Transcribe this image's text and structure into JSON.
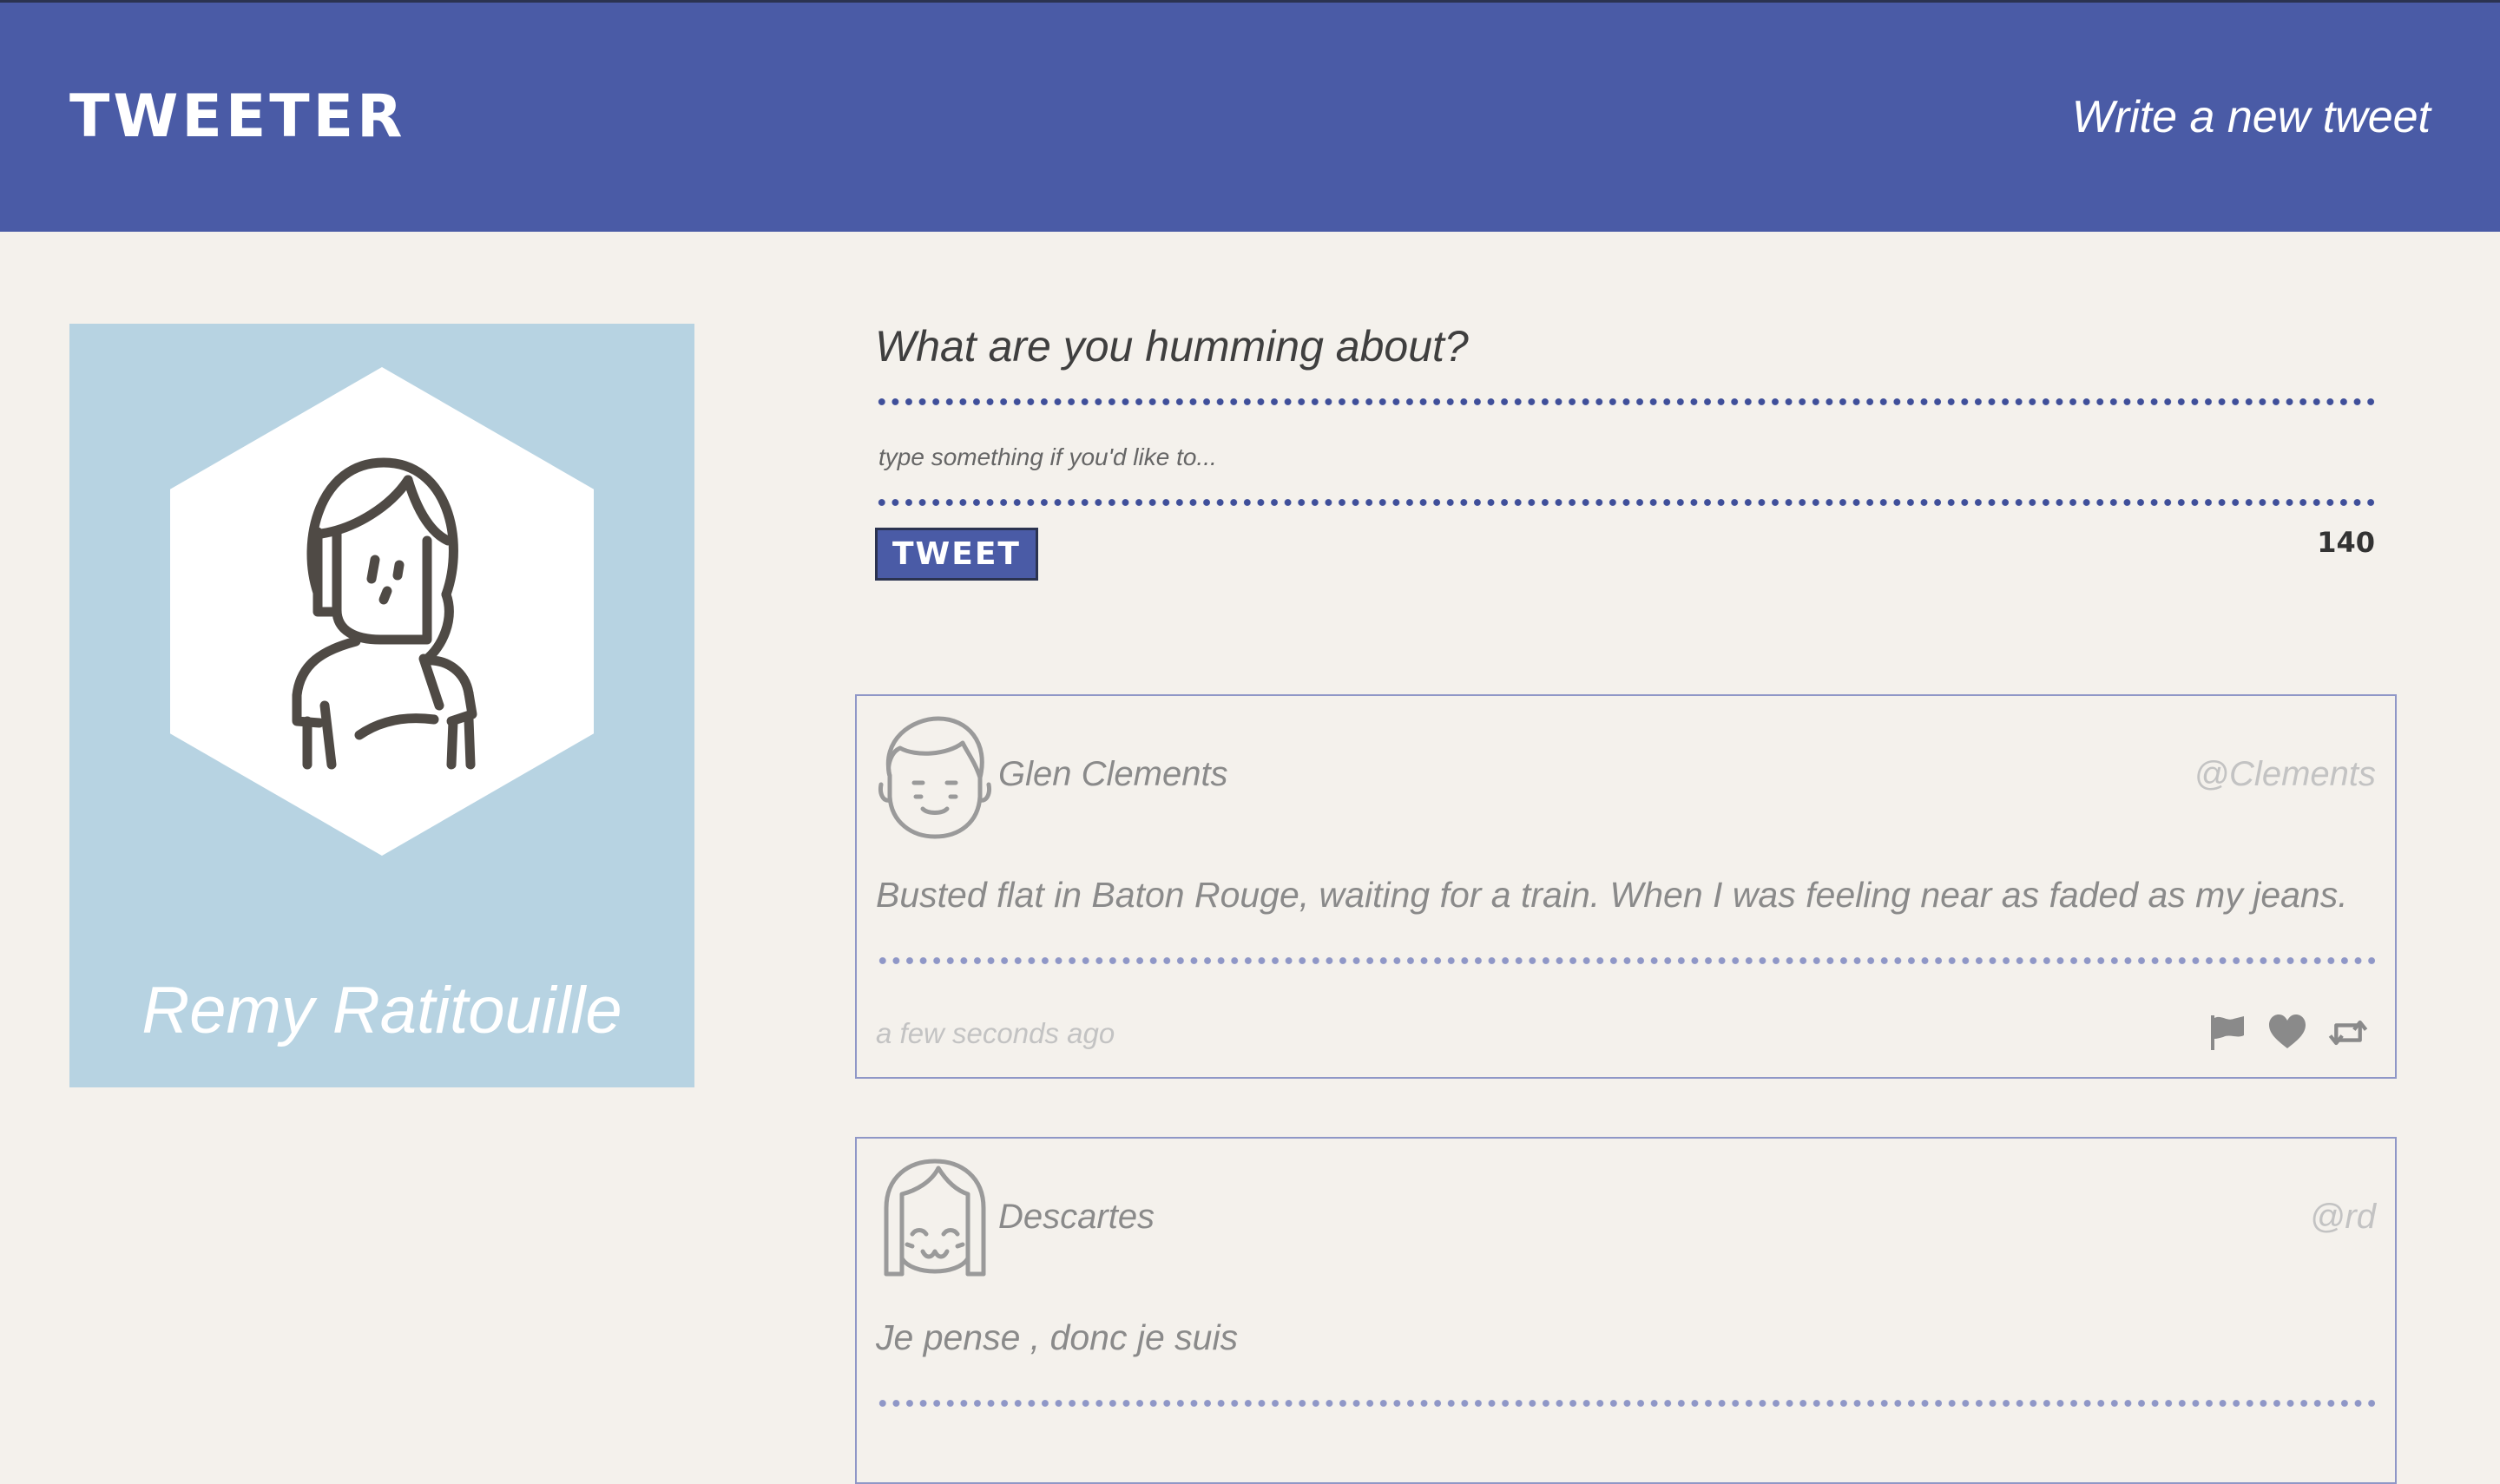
{
  "header": {
    "brand": "TWEETER",
    "compose_link": "Write a new tweet"
  },
  "profile": {
    "name": "Remy Ratitouille",
    "avatar_icon": "avatar-girl-icon"
  },
  "composer": {
    "heading": "What are you humming about?",
    "placeholder": "type something if you'd like to...",
    "button_label": "TWEET",
    "char_count": "140"
  },
  "tweets": [
    {
      "avatar_icon": "avatar-boy-icon",
      "author": "Glen Clements",
      "handle": "@Clements",
      "text": "Busted flat in Baton Rouge, waiting for a train. When I was feeling near as faded as my jeans.",
      "time": "a few seconds ago",
      "actions": [
        "flag-icon",
        "heart-icon",
        "retweet-icon"
      ]
    },
    {
      "avatar_icon": "avatar-girl-icon",
      "author": "Descartes",
      "handle": "@rd",
      "text": "Je pense , donc je suis"
    }
  ],
  "colors": {
    "header_bg": "#4a5ba6",
    "page_bg": "#f4f1ec",
    "profile_bg": "#b7d3e2",
    "accent_dots": "#3f4f9a",
    "tweet_border": "#8f97c7"
  }
}
